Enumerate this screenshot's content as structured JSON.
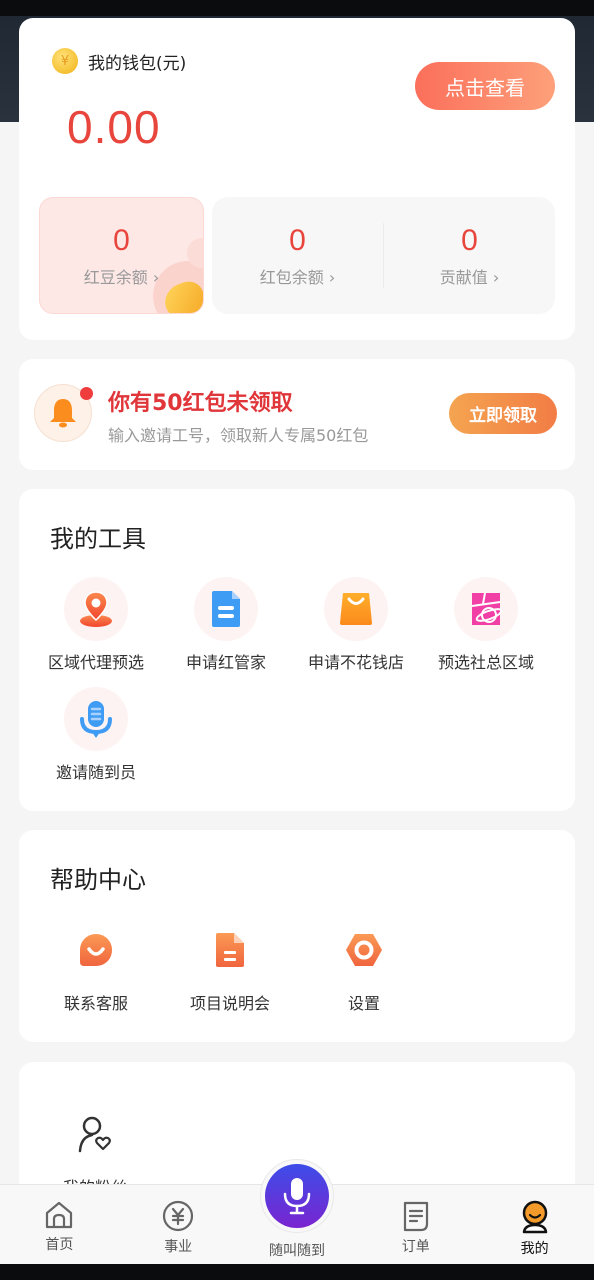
{
  "wallet": {
    "title": "我的钱包(元)",
    "coin_symbol": "¥",
    "amount": "0.00",
    "view_button": "点击查看",
    "stats": [
      {
        "value": "0",
        "label": "红豆余额 ›"
      },
      {
        "value": "0",
        "label": "红包余额 ›"
      },
      {
        "value": "0",
        "label": "贡献值 ›"
      }
    ]
  },
  "invite": {
    "title": "你有50红包未领取",
    "subtitle": "输入邀请工号，领取新人专属50红包",
    "button": "立即领取"
  },
  "tools": {
    "title": "我的工具",
    "items": [
      {
        "label": "区域代理预选",
        "icon": "location-person-icon"
      },
      {
        "label": "申请红管家",
        "icon": "document-icon"
      },
      {
        "label": "申请不花钱店",
        "icon": "shopping-bag-icon"
      },
      {
        "label": "预选社总区域",
        "icon": "planet-map-icon"
      },
      {
        "label": "邀请随到员",
        "icon": "microphone-icon"
      }
    ]
  },
  "help": {
    "title": "帮助中心",
    "items": [
      {
        "label": "联系客服",
        "icon": "chat-smile-icon"
      },
      {
        "label": "项目说明会",
        "icon": "file-icon"
      },
      {
        "label": "设置",
        "icon": "settings-hexagon-icon"
      }
    ]
  },
  "fans": {
    "items": [
      {
        "label": "我的粉丝",
        "icon": "user-heart-icon"
      }
    ]
  },
  "nav": {
    "items": [
      {
        "label": "首页",
        "icon": "home-icon"
      },
      {
        "label": "事业",
        "icon": "yen-circle-icon"
      },
      {
        "label": "随叫随到",
        "icon": "microphone-icon"
      },
      {
        "label": "订单",
        "icon": "order-list-icon"
      },
      {
        "label": "我的",
        "icon": "profile-icon",
        "active": true
      }
    ]
  },
  "colors": {
    "accent_red": "#e8453c",
    "button_orange": "#fb6f5b",
    "claim_orange": "#f27d45",
    "mic_gradient_top": "#3d4de8",
    "mic_gradient_bottom": "#7a25d0"
  }
}
